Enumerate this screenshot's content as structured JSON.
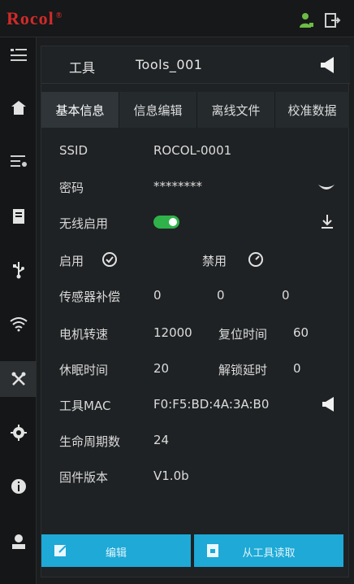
{
  "app": {
    "logo": "Rocol",
    "reg_mark": "®"
  },
  "tool_bar": {
    "label": "工具",
    "name": "Tools_001"
  },
  "tabs": [
    {
      "label": "基本信息",
      "active": true
    },
    {
      "label": "信息编辑",
      "active": false
    },
    {
      "label": "离线文件",
      "active": false
    },
    {
      "label": "校准数据",
      "active": false
    }
  ],
  "info": {
    "ssid_label": "SSID",
    "ssid_value": "ROCOL-0001",
    "password_label": "密码",
    "password_value": "********",
    "wireless_label": "无线启用",
    "wireless_on": true,
    "enable_label": "启用",
    "disable_label": "禁用",
    "sensor_label": "传感器补偿",
    "sensor_values": [
      "0",
      "0",
      "0"
    ],
    "motor_label": "电机转速",
    "motor_value": "12000",
    "reset_label": "复位时间",
    "reset_value": "60",
    "sleep_label": "休眠时间",
    "sleep_value": "20",
    "unlock_label": "解锁延时",
    "unlock_value": "0",
    "mac_label": "工具MAC",
    "mac_value": "F0:F5:BD:4A:3A:B0",
    "life_label": "生命周期数",
    "life_value": "24",
    "firmware_label": "固件版本",
    "firmware_value": "V1.0b"
  },
  "buttons": {
    "edit_label": "编辑",
    "read_label": "从工具读取"
  },
  "colors": {
    "accent": "#1ea9d6",
    "toggle_on": "#2fb24a",
    "logo_red": "#d12a2a",
    "user_green": "#6dbb45"
  }
}
